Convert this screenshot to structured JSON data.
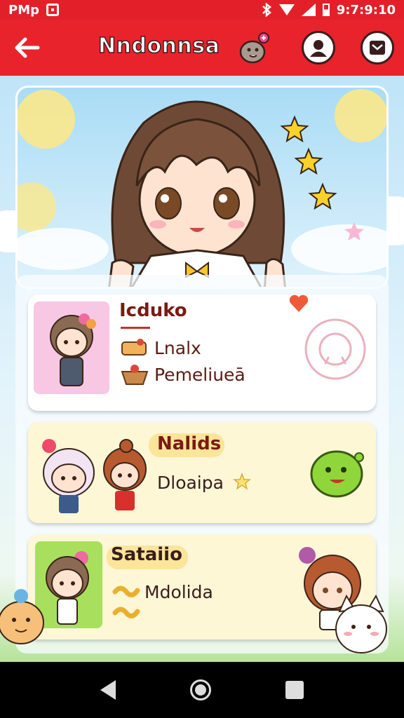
{
  "status_bar": {
    "left_text": "PMp",
    "time": "9:7:9:10"
  },
  "app_bar": {
    "title": "Nndonnsa",
    "icons": [
      "back-arrow-icon",
      "mascot-icon",
      "profile-icon",
      "inbox-icon"
    ]
  },
  "cards": [
    {
      "name": "Icduko",
      "line1": "Lnalx",
      "line2": "Pemeliueā",
      "action_icon": "heart-icon"
    },
    {
      "name": "Nalids",
      "line1": "Dloaipa",
      "action_icon": "slime-icon"
    },
    {
      "name": "Sataiio",
      "line1": "Mdolida"
    }
  ],
  "colors": {
    "brand_red": "#e8232c",
    "card_cream": "#fdf7d6",
    "text_brown": "#7a1a12"
  }
}
